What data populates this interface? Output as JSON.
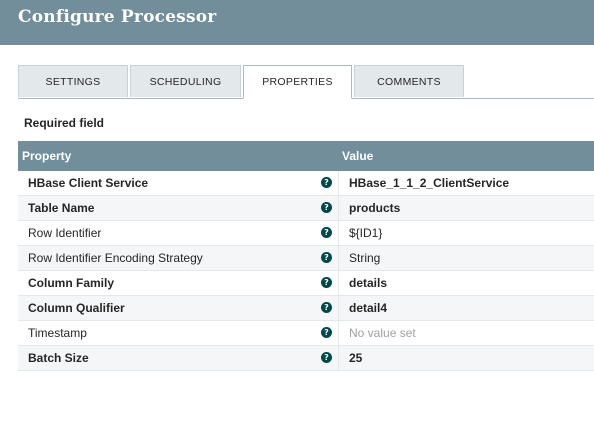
{
  "dialog": {
    "title": "Configure Processor"
  },
  "tabs": [
    {
      "label": "SETTINGS"
    },
    {
      "label": "SCHEDULING"
    },
    {
      "label": "PROPERTIES"
    },
    {
      "label": "COMMENTS"
    }
  ],
  "active_tab": "PROPERTIES",
  "required_field_label": "Required field",
  "grid": {
    "header_property": "Property",
    "header_value": "Value",
    "help_icon": "question-circle-icon",
    "rows": [
      {
        "property": "HBase Client Service",
        "value": "HBase_1_1_2_ClientService"
      },
      {
        "property": "Table Name",
        "value": "products"
      },
      {
        "property": "Row Identifier",
        "value": "${ID1}"
      },
      {
        "property": "Row Identifier Encoding Strategy",
        "value": "String"
      },
      {
        "property": "Column Family",
        "value": "details"
      },
      {
        "property": "Column Qualifier",
        "value": "detail4"
      },
      {
        "property": "Timestamp",
        "value": "No value set"
      },
      {
        "property": "Batch Size",
        "value": "25"
      }
    ]
  },
  "colors": {
    "header_bg": "#728e9b",
    "help_icon": "#004849",
    "unset_text": "#a0a0a0"
  }
}
